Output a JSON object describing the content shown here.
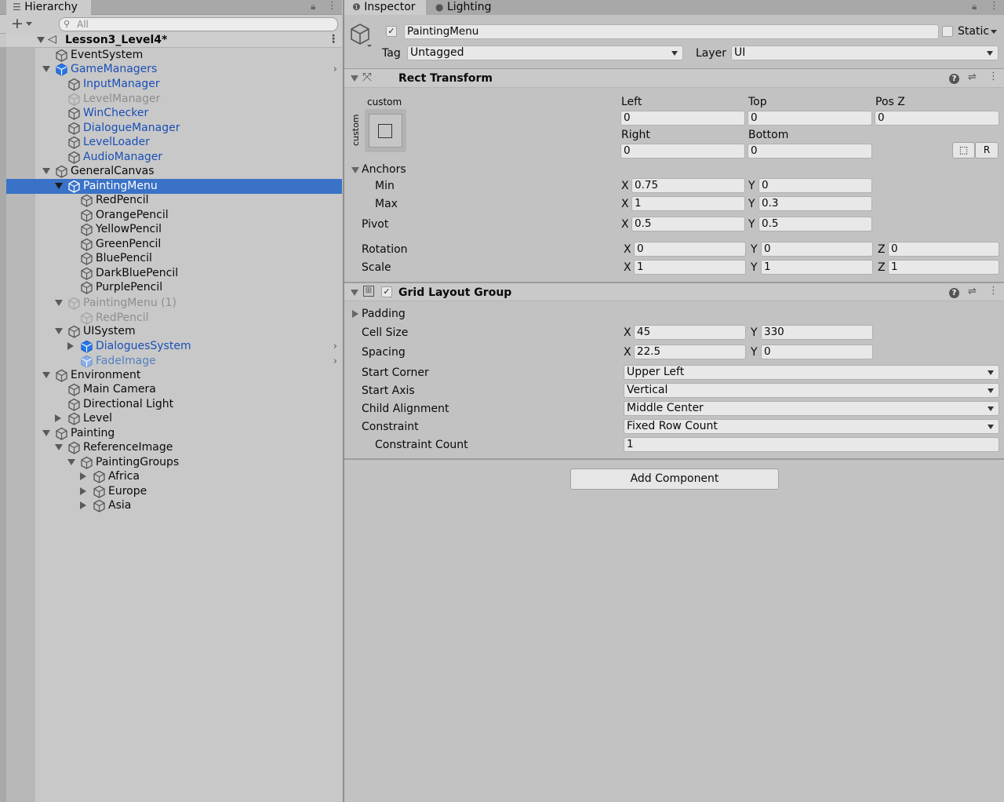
{
  "hierarchy": {
    "tab_label": "Hierarchy",
    "add_label": "+",
    "search_placeholder": "All",
    "scene": "Lesson3_Level4*",
    "items": [
      {
        "label": "EventSystem"
      },
      {
        "label": "GameManagers"
      },
      {
        "label": "InputManager"
      },
      {
        "label": "LevelManager"
      },
      {
        "label": "WinChecker"
      },
      {
        "label": "DialogueManager"
      },
      {
        "label": "LevelLoader"
      },
      {
        "label": "AudioManager"
      },
      {
        "label": "GeneralCanvas"
      },
      {
        "label": "PaintingMenu"
      },
      {
        "label": "RedPencil"
      },
      {
        "label": "OrangePencil"
      },
      {
        "label": "YellowPencil"
      },
      {
        "label": "GreenPencil"
      },
      {
        "label": "BluePencil"
      },
      {
        "label": "DarkBluePencil"
      },
      {
        "label": "PurplePencil"
      },
      {
        "label": "PaintingMenu (1)"
      },
      {
        "label": "RedPencil"
      },
      {
        "label": "UISystem"
      },
      {
        "label": "DialoguesSystem"
      },
      {
        "label": "FadeImage"
      },
      {
        "label": "Environment"
      },
      {
        "label": "Main Camera"
      },
      {
        "label": "Directional Light"
      },
      {
        "label": "Level"
      },
      {
        "label": "Painting"
      },
      {
        "label": "ReferenceImage"
      },
      {
        "label": "PaintingGroups"
      },
      {
        "label": "Africa"
      },
      {
        "label": "Europe"
      },
      {
        "label": "Asia"
      }
    ]
  },
  "inspector": {
    "tab_inspector": "Inspector",
    "tab_lighting": "Lighting",
    "object_name": "PaintingMenu",
    "static_label": "Static",
    "tag_label": "Tag",
    "tag_value": "Untagged",
    "layer_label": "Layer",
    "layer_value": "UI",
    "rect_transform": {
      "title": "Rect Transform",
      "preset_top": "custom",
      "preset_side": "custom",
      "left_label": "Left",
      "left": "0",
      "top_label": "Top",
      "top": "0",
      "posz_label": "Pos Z",
      "posz": "0",
      "right_label": "Right",
      "right": "0",
      "bottom_label": "Bottom",
      "bottom": "0",
      "r_button": "R",
      "anchors_label": "Anchors",
      "min_label": "Min",
      "min_x": "0.75",
      "min_y": "0",
      "max_label": "Max",
      "max_x": "1",
      "max_y": "0.3",
      "pivot_label": "Pivot",
      "pivot_x": "0.5",
      "pivot_y": "0.5",
      "rotation_label": "Rotation",
      "rot_x": "0",
      "rot_y": "0",
      "rot_z": "0",
      "scale_label": "Scale",
      "scale_x": "1",
      "scale_y": "1",
      "scale_z": "1",
      "x": "X",
      "y": "Y",
      "z": "Z"
    },
    "grid_layout": {
      "title": "Grid Layout Group",
      "padding_label": "Padding",
      "cell_size_label": "Cell Size",
      "cell_x": "45",
      "cell_y": "330",
      "spacing_label": "Spacing",
      "spacing_x": "22.5",
      "spacing_y": "0",
      "start_corner_label": "Start Corner",
      "start_corner": "Upper Left",
      "start_axis_label": "Start Axis",
      "start_axis": "Vertical",
      "child_alignment_label": "Child Alignment",
      "child_alignment": "Middle Center",
      "constraint_label": "Constraint",
      "constraint": "Fixed Row Count",
      "constraint_count_label": "Constraint Count",
      "constraint_count": "1"
    },
    "add_component": "Add Component"
  },
  "colors": {
    "selection": "#3a72c7",
    "prefab_blue": "#1a4fb5",
    "panel": "#c2c2c2"
  }
}
